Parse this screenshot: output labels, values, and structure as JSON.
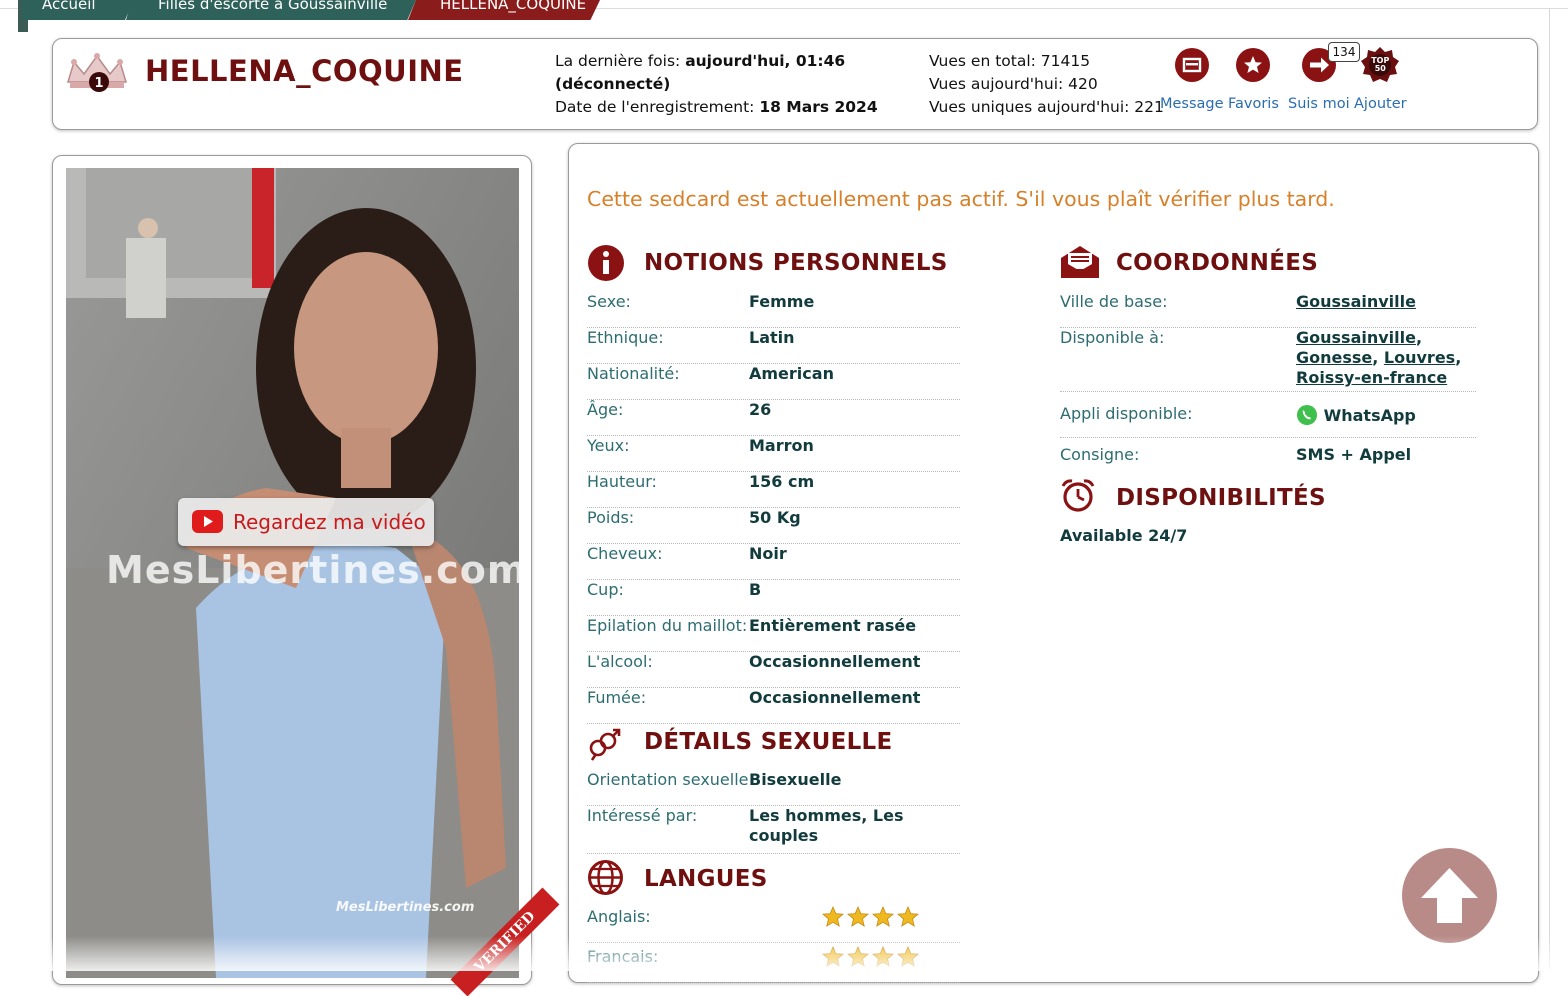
{
  "breadcrumb": {
    "home": "Accueil",
    "category": "Filles d'escorte à Goussainville",
    "current": "HELLENA_COQUINE"
  },
  "profile": {
    "rank": "1",
    "username": "HELLENA_COQUINE",
    "last_seen_label": "La dernière fois:",
    "last_seen_value": "aujourd'hui, 01:46",
    "status": "(déconnecté)",
    "registered_label": "Date de l'enregistrement:",
    "registered_value": "18 Mars 2024",
    "views_total": "Vues en total: 71415",
    "views_today": "Vues aujourd'hui: 420",
    "views_unique": "Vues uniques aujourd'hui: 221"
  },
  "actions": {
    "message": "Message",
    "favoris": "Favoris",
    "suis_moi": "Suis moi",
    "suis_moi_count": "134",
    "ajouter": "Ajouter",
    "top_badge": "TOP 50"
  },
  "photo": {
    "video_button": "Regardez ma vidéo",
    "watermark": "MesLibertines.com",
    "watermark_small": "MesLibertines.com",
    "verified": "VERIFIED"
  },
  "notice": "Cette sedcard est actuellement pas actif. S'il vous plaît vérifier plus tard.",
  "personal": {
    "title": "NOTIONS PERSONNELS",
    "rows": [
      {
        "k": "Sexe:",
        "v": "Femme"
      },
      {
        "k": "Ethnique:",
        "v": "Latin"
      },
      {
        "k": "Nationalité:",
        "v": "American"
      },
      {
        "k": "Âge:",
        "v": "26"
      },
      {
        "k": "Yeux:",
        "v": "Marron"
      },
      {
        "k": "Hauteur:",
        "v": "156 cm"
      },
      {
        "k": "Poids:",
        "v": "50 Kg"
      },
      {
        "k": "Cheveux:",
        "v": "Noir"
      },
      {
        "k": "Cup:",
        "v": "B"
      },
      {
        "k": "Epilation du maillot:",
        "v": "Entièrement rasée"
      },
      {
        "k": "L'alcool:",
        "v": "Occasionnellement"
      },
      {
        "k": "Fumée:",
        "v": "Occasionnellement"
      }
    ]
  },
  "sexual": {
    "title": "DÉTAILS SEXUELLE",
    "orientation_label": "Orientation sexuelle",
    "orientation_value": "Bisexuelle",
    "interested_label": "Intéressé par:",
    "interested_value": "Les hommes, Les couples"
  },
  "languages": {
    "title": "LANGUES",
    "items": [
      {
        "name": "Anglais:",
        "stars": 4
      },
      {
        "name": "Francais:",
        "stars": 4
      }
    ]
  },
  "contact": {
    "title": "COORDONNÉES",
    "city_label": "Ville de base:",
    "city_value": "Goussainville",
    "available_label": "Disponible à:",
    "available_places": [
      "Goussainville",
      "Gonesse",
      "Louvres",
      "Roissy-en-france"
    ],
    "app_label": "Appli disponible:",
    "app_value": "WhatsApp",
    "consigne_label": "Consigne:",
    "consigne_value": "SMS + Appel"
  },
  "availability": {
    "title": "DISPONIBILITÉS",
    "value": "Available 24/7"
  },
  "colors": {
    "brand_dark_red": "#6f1010",
    "icon_red": "#8a1212",
    "teal": "#2e6159",
    "link_blue": "#2a6db0",
    "notice_orange": "#d7802a"
  }
}
